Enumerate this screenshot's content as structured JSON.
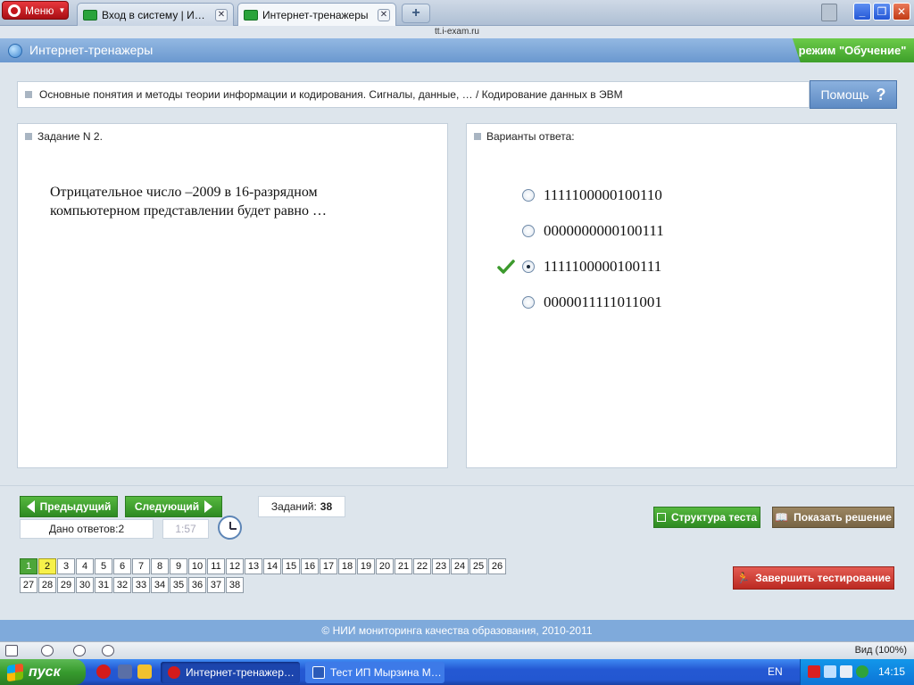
{
  "browser": {
    "menu_label": "Меню",
    "tabs": [
      {
        "title": "Вход в систему | Интер…",
        "close": "✕"
      },
      {
        "title": "Интернет-тренажеры",
        "close": "✕"
      }
    ],
    "newtab_label": "+",
    "url": "tt.i-exam.ru",
    "window_buttons": {
      "minimize": "_",
      "maximize": "❐",
      "close": "✕"
    }
  },
  "app": {
    "title": "Интернет-тренажеры",
    "mode": "режим \"Обучение\"",
    "breadcrumb": "Основные понятия и методы теории информации и кодирования. Сигналы, данные, … / Кодирование данных в ЭВМ",
    "help_label": "Помощь",
    "help_icon": "?"
  },
  "question": {
    "header": "Задание N 2.",
    "text_line1": "Отрицательное число  –2009 в 16-разрядном",
    "text_line2": "компьютерном представлении будет равно …"
  },
  "answers": {
    "header": "Варианты ответа:",
    "options": [
      {
        "value": "1111100000100110",
        "selected": false,
        "correct": false
      },
      {
        "value": "0000000000100111",
        "selected": false,
        "correct": false
      },
      {
        "value": "1111100000100111",
        "selected": true,
        "correct": true
      },
      {
        "value": "0000011111011001",
        "selected": false,
        "correct": false
      }
    ]
  },
  "controls": {
    "prev_label": "Предыдущий",
    "next_label": "Следующий",
    "tasks_label": "Заданий:",
    "tasks_count": "38",
    "answered_label": "Дано ответов:",
    "answered_count": "2",
    "timer": "1:57",
    "structure_label": "Структура теста",
    "solution_label": "Показать решение",
    "finish_label": "Завершить тестирование"
  },
  "task_grid": {
    "row1": [
      "1",
      "2",
      "3",
      "4",
      "5",
      "6",
      "7",
      "8",
      "9",
      "10",
      "11",
      "12",
      "13",
      "14",
      "15",
      "16",
      "17",
      "18",
      "19",
      "20",
      "21",
      "22",
      "23",
      "24",
      "25",
      "26"
    ],
    "row2": [
      "27",
      "28",
      "29",
      "30",
      "31",
      "32",
      "33",
      "34",
      "35",
      "36",
      "37",
      "38"
    ],
    "done": [
      "1"
    ],
    "current": "2"
  },
  "footer": "© НИИ мониторинга качества образования, 2010-2011",
  "statusbar": {
    "zoom": "Вид (100%)"
  },
  "taskbar": {
    "start_label": "пуск",
    "items": [
      {
        "label": "Интернет-тренажер…"
      },
      {
        "label": "Тест ИП Мырзина М…"
      }
    ],
    "lang": "EN",
    "time": "14:15"
  },
  "colors": {
    "header_blue": "#7ea7d8",
    "mode_green": "#4fb535",
    "nav_green": "#3f9e2e",
    "finish_red": "#d2413a",
    "solution_brown": "#8a7452"
  }
}
